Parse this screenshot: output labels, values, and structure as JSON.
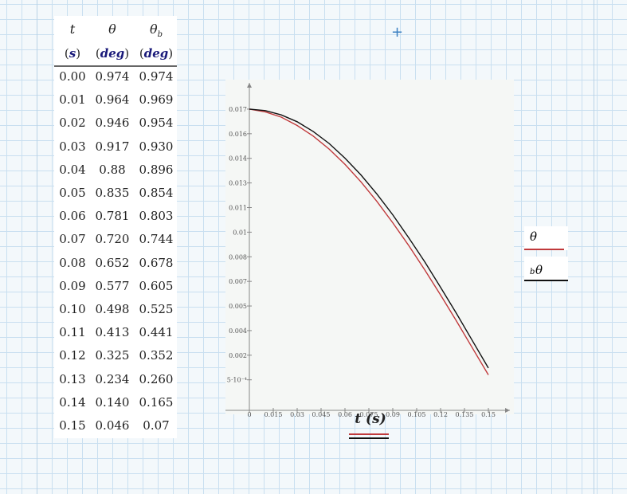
{
  "table": {
    "headers": [
      {
        "symbol": "t",
        "sub": "",
        "unit": "s"
      },
      {
        "symbol": "θ",
        "sub": "",
        "unit": "deg"
      },
      {
        "symbol": "θ",
        "sub": "b",
        "unit": "deg"
      }
    ],
    "rows": [
      [
        "0.00",
        "0.974",
        "0.974"
      ],
      [
        "0.01",
        "0.964",
        "0.969"
      ],
      [
        "0.02",
        "0.946",
        "0.954"
      ],
      [
        "0.03",
        "0.917",
        "0.930"
      ],
      [
        "0.04",
        "0.88",
        "0.896"
      ],
      [
        "0.05",
        "0.835",
        "0.854"
      ],
      [
        "0.06",
        "0.781",
        "0.803"
      ],
      [
        "0.07",
        "0.720",
        "0.744"
      ],
      [
        "0.08",
        "0.652",
        "0.678"
      ],
      [
        "0.09",
        "0.577",
        "0.605"
      ],
      [
        "0.10",
        "0.498",
        "0.525"
      ],
      [
        "0.11",
        "0.413",
        "0.441"
      ],
      [
        "0.12",
        "0.325",
        "0.352"
      ],
      [
        "0.13",
        "0.234",
        "0.260"
      ],
      [
        "0.14",
        "0.140",
        "0.165"
      ],
      [
        "0.15",
        "0.046",
        "0.07"
      ]
    ]
  },
  "chart_data": {
    "type": "line",
    "xlabel": "t (s)",
    "x": [
      0,
      0.01,
      0.02,
      0.03,
      0.04,
      0.05,
      0.06,
      0.07,
      0.08,
      0.09,
      0.1,
      0.11,
      0.12,
      0.13,
      0.14,
      0.15
    ],
    "series": [
      {
        "name": "θ",
        "color": "#c0393b",
        "values": [
          0.017,
          0.01683,
          0.01651,
          0.016,
          0.01536,
          0.01457,
          0.01363,
          0.01257,
          0.01138,
          0.01007,
          0.00869,
          0.00721,
          0.00567,
          0.00408,
          0.00244,
          0.0008
        ]
      },
      {
        "name": "θb",
        "color": "#111111",
        "values": [
          0.017,
          0.01691,
          0.01665,
          0.01623,
          0.01564,
          0.01491,
          0.01401,
          0.01299,
          0.01183,
          0.01056,
          0.00916,
          0.0077,
          0.00614,
          0.00454,
          0.00288,
          0.00122
        ]
      }
    ],
    "xlim": [
      -0.015,
      0.1635
    ],
    "ylim": [
      -0.00136,
      0.0186
    ],
    "x_ticks": [
      {
        "v": 0,
        "label": "0"
      },
      {
        "v": 0.015,
        "label": "0.015"
      },
      {
        "v": 0.03,
        "label": "0.03"
      },
      {
        "v": 0.045,
        "label": "0.045"
      },
      {
        "v": 0.06,
        "label": "0.06"
      },
      {
        "v": 0.075,
        "label": "0.075"
      },
      {
        "v": 0.09,
        "label": "0.09"
      },
      {
        "v": 0.105,
        "label": "0.105"
      },
      {
        "v": 0.12,
        "label": "0.12"
      },
      {
        "v": 0.135,
        "label": "0.135"
      },
      {
        "v": 0.15,
        "label": "0.15"
      }
    ],
    "y_ticks": [
      {
        "v": 0.0005,
        "label": "5·10⁻⁴"
      },
      {
        "v": 0.002,
        "label": "0.002"
      },
      {
        "v": 0.0035,
        "label": "0.004"
      },
      {
        "v": 0.005,
        "label": "0.005"
      },
      {
        "v": 0.0065,
        "label": "0.007"
      },
      {
        "v": 0.008,
        "label": "0.008"
      },
      {
        "v": 0.0095,
        "label": "0.01"
      },
      {
        "v": 0.011,
        "label": "0.011"
      },
      {
        "v": 0.0125,
        "label": "0.013"
      },
      {
        "v": 0.014,
        "label": "0.014"
      },
      {
        "v": 0.0155,
        "label": "0.016"
      },
      {
        "v": 0.017,
        "label": "0.017"
      }
    ],
    "grid": false,
    "legend": "right"
  },
  "xaxis_label": {
    "symbol": "t",
    "unit": "s"
  },
  "legend": [
    {
      "symbol": "θ",
      "sub": ""
    },
    {
      "symbol": "θ",
      "sub": "b"
    }
  ]
}
